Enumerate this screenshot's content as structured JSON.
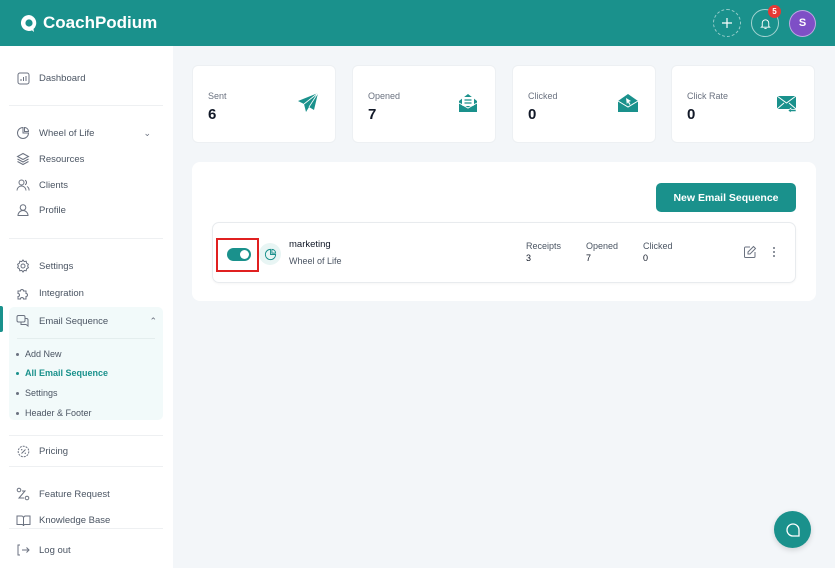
{
  "app": {
    "name": "CoachPodium"
  },
  "header": {
    "add_icon": "plus-icon",
    "notifications": {
      "icon": "bell-icon",
      "count": "5"
    },
    "avatar_initial": "S",
    "avatar_color": "#7e4fc6"
  },
  "colors": {
    "brand": "#1a918c",
    "badge": "#e53935",
    "highlight": "#e02020"
  },
  "sidebar": {
    "dashboard": "Dashboard",
    "wheel_of_life": "Wheel of Life",
    "resources": "Resources",
    "clients": "Clients",
    "profile": "Profile",
    "settings": "Settings",
    "integration": "Integration",
    "email_sequence": "Email Sequence",
    "email_sub": [
      "Add New",
      "All Email Sequence",
      "Settings",
      "Header & Footer"
    ],
    "email_sub_active": "All Email Sequence",
    "pricing": "Pricing",
    "feature_request": "Feature Request",
    "knowledge_base": "Knowledge Base",
    "logout": "Log out"
  },
  "stats": [
    {
      "label": "Sent",
      "value": "6",
      "icon": "paper-plane-icon"
    },
    {
      "label": "Opened",
      "value": "7",
      "icon": "open-envelope-icon"
    },
    {
      "label": "Clicked",
      "value": "0",
      "icon": "envelope-click-icon"
    },
    {
      "label": "Click Rate",
      "value": "0",
      "icon": "envelope-reply-icon"
    }
  ],
  "panel": {
    "new_button": "New Email Sequence",
    "sequences": [
      {
        "name": "marketing",
        "subtitle": "Wheel of Life",
        "enabled": true,
        "metrics": [
          {
            "label": "Receipts",
            "value": "3"
          },
          {
            "label": "Opened",
            "value": "7"
          },
          {
            "label": "Clicked",
            "value": "0"
          }
        ]
      }
    ]
  }
}
